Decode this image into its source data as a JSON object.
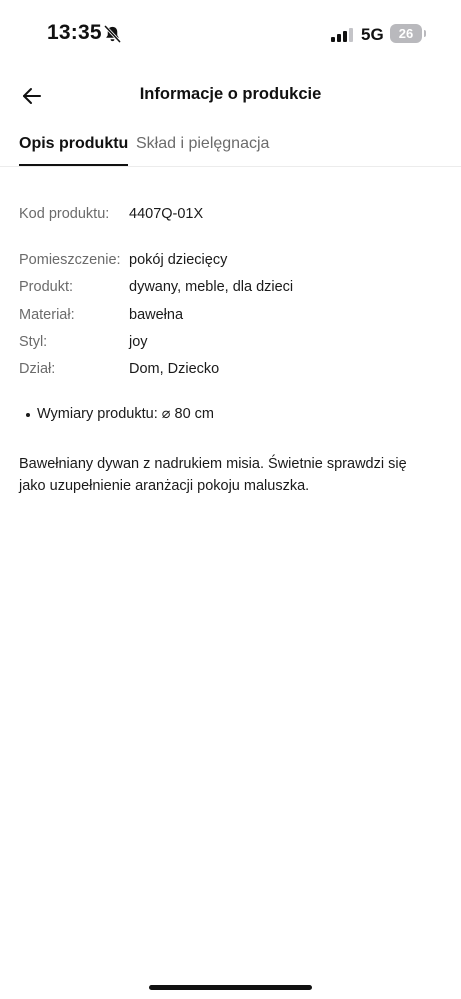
{
  "status_bar": {
    "time": "13:35",
    "network": "5G",
    "battery": "26",
    "icons": [
      "bell-slash-icon",
      "cellular-signal-icon",
      "battery-icon"
    ]
  },
  "header": {
    "title": "Informacje o produkcie",
    "back_icon": "arrow-left-icon"
  },
  "tabs": [
    {
      "label": "Opis produktu",
      "active": true
    },
    {
      "label": "Skład i pielęgnacja",
      "active": false
    }
  ],
  "details": {
    "code": {
      "label": "Kod produktu:",
      "value": "4407Q-01X"
    },
    "attributes": [
      {
        "label": "Pomieszczenie:",
        "value": "pokój dziecięcy"
      },
      {
        "label": "Produkt:",
        "value": "dywany, meble, dla dzieci"
      },
      {
        "label": "Materiał:",
        "value": "bawełna"
      },
      {
        "label": "Styl:",
        "value": "joy"
      },
      {
        "label": "Dział:",
        "value": "Dom, Dziecko"
      }
    ]
  },
  "bullets": [
    "Wymiary produktu: ⌀ 80 cm"
  ],
  "description": "Bawełniany dywan z nadrukiem misia. Świetnie sprawdzi się jako uzupełnienie aranżacji pokoju maluszka.",
  "colors": {
    "text": "#1a1a1a",
    "muted": "#6b6b6b",
    "divider": "#ececec",
    "battery": "#b9b9bd"
  }
}
